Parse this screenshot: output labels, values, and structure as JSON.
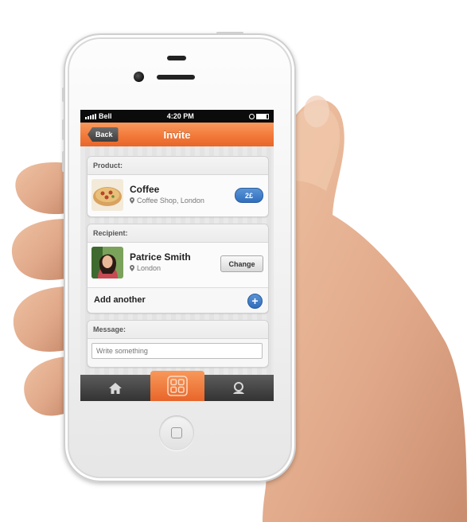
{
  "status_bar": {
    "carrier": "Bell",
    "time": "4:20 PM"
  },
  "nav": {
    "back_label": "Back",
    "title": "Invite"
  },
  "product": {
    "section_label": "Product:",
    "name": "Coffee",
    "location": "Coffee Shop, London",
    "price": "2£",
    "thumb_icon": "pizza-thumbnail"
  },
  "recipient": {
    "section_label": "Recipient:",
    "name": "Patrice Smith",
    "location": "London",
    "change_label": "Change",
    "add_another_label": "Add another",
    "avatar_icon": "person-avatar"
  },
  "message": {
    "section_label": "Message:",
    "placeholder": "Write something"
  },
  "tab_bar": {
    "tabs": [
      {
        "icon": "home-icon",
        "active": false
      },
      {
        "icon": "grid-icon",
        "active": true
      },
      {
        "icon": "profile-icon",
        "active": false
      }
    ]
  },
  "colors": {
    "accent": "#f27a3a",
    "badge_blue": "#2f6fbf",
    "bar_dark": "#333333"
  }
}
